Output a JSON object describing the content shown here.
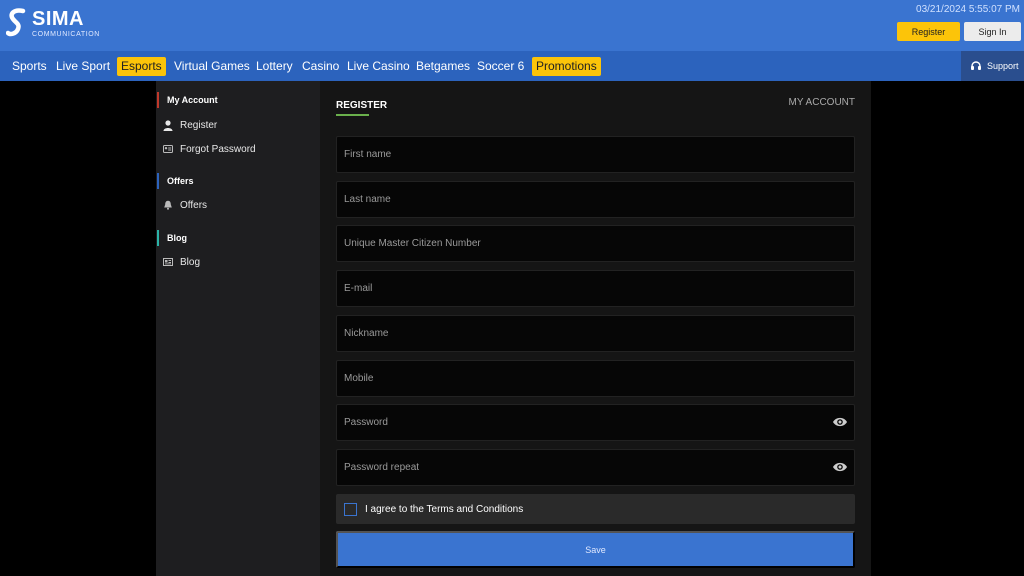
{
  "brand": {
    "name": "SIMA",
    "subtitle": "COMMUNICATION"
  },
  "header": {
    "datetime": "03/21/2024 5:55:07 PM",
    "register_label": "Register",
    "signin_label": "Sign In"
  },
  "nav": {
    "items": [
      {
        "label": "Sports"
      },
      {
        "label": "Live Sport"
      },
      {
        "label": "Esports"
      },
      {
        "label": "Virtual Games"
      },
      {
        "label": "Lottery"
      },
      {
        "label": "Casino"
      },
      {
        "label": "Live Casino"
      },
      {
        "label": "Betgames"
      },
      {
        "label": "Soccer 6"
      },
      {
        "label": "Promotions"
      }
    ],
    "support_label": "Support"
  },
  "sidebar": {
    "sections": [
      {
        "title": "My Account",
        "accent": "#c0392b",
        "items": [
          {
            "label": "Register",
            "icon": "user-icon"
          },
          {
            "label": "Forgot Password",
            "icon": "id-card-icon"
          }
        ]
      },
      {
        "title": "Offers",
        "accent": "#2c63bd",
        "items": [
          {
            "label": "Offers",
            "icon": "bell-icon"
          }
        ]
      },
      {
        "title": "Blog",
        "accent": "#2bb3a8",
        "items": [
          {
            "label": "Blog",
            "icon": "news-icon"
          }
        ]
      }
    ]
  },
  "form": {
    "title": "REGISTER",
    "my_account_link": "MY ACCOUNT",
    "fields": {
      "first_name": "First name",
      "last_name": "Last name",
      "citizen_number": "Unique Master Citizen Number",
      "email": "E-mail",
      "nickname": "Nickname",
      "mobile": "Mobile",
      "password": "Password",
      "password_repeat": "Password repeat"
    },
    "terms_label": "I agree to the Terms and Conditions",
    "save_label": "Save"
  },
  "colors": {
    "topbar": "#3a74d0",
    "navbar": "#2c63bd",
    "highlight": "#fcc409",
    "accent_green": "#6ab04c"
  }
}
